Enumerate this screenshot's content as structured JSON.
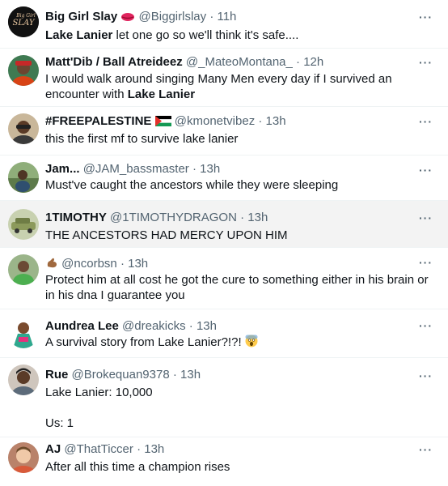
{
  "tweets": [
    {
      "name": "Big Girl Slay",
      "handle": "@Biggirlslay",
      "time": "11h",
      "text_bold": "Lake Lanier",
      "text": " let one go so we'll think it's safe....",
      "avatar_icon": "slay-logo-avatar"
    },
    {
      "name": "Matt'Dib / Ball Atreideez",
      "handle": "@_MateoMontana_",
      "time": "12h",
      "text": "I would walk around singing Many Men every day if I survived an encounter with ",
      "text_bold": "Lake Lanier",
      "avatar_icon": "person-avatar"
    },
    {
      "name": "#FREEPALESTINE",
      "handle": "@kmonetvibez",
      "time": "13h",
      "text": "this the first mf to survive lake lanier",
      "name_icon": "palestine-flag-icon"
    },
    {
      "name": "Jam...",
      "handle": "@JAM_bassmaster",
      "time": "13h",
      "text": "Must've caught the ancestors while they were sleeping"
    },
    {
      "name": "1TIMOTHY",
      "handle": "@1TIMOTHYDRAGON",
      "time": "13h",
      "text": "THE ANCESTORS HAD MERCY UPON HIM"
    },
    {
      "name": "",
      "handle": "@ncorbsn",
      "time": "13h",
      "text": "Protect him at all cost he got the cure to something either in his brain or in his dna I guarantee you",
      "name_icon": "flexed-arm-emoji-icon"
    },
    {
      "name": "Aundrea Lee",
      "handle": "@dreakicks",
      "time": "13h",
      "text": "A survival story from Lake Lanier?!?! ",
      "text_icon": "screaming-face-emoji-icon"
    },
    {
      "name": "Rue",
      "handle": "@Brokequan9378",
      "time": "13h",
      "text_line1": "Lake Lanier: 10,000",
      "text_line2": "Us: 1"
    },
    {
      "name": "AJ",
      "handle": "@ThatTiccer",
      "time": "13h",
      "text": "After all this time a champion rises"
    }
  ],
  "separator": "·",
  "more_label": "···",
  "colors": {
    "text": "#0f1419",
    "secondary": "#536471",
    "divider": "#eff3f4",
    "highlight_bg": "#f3f3f3",
    "heart_red": "#e0245e"
  }
}
